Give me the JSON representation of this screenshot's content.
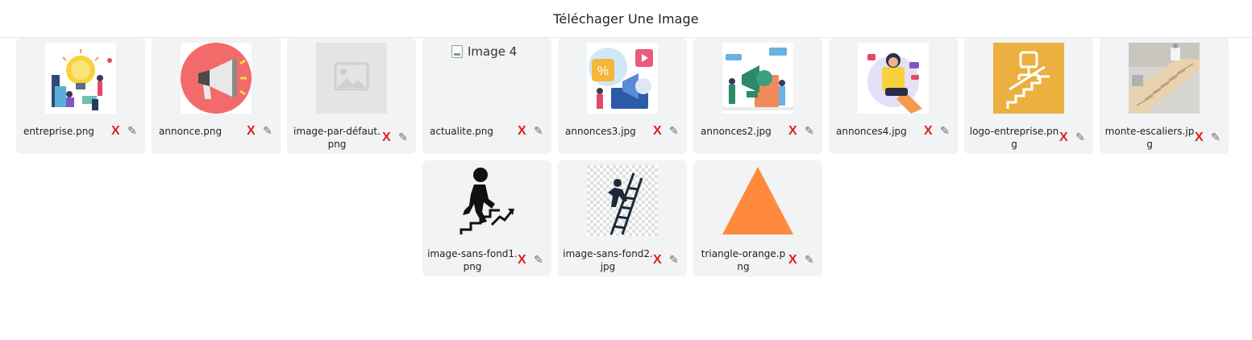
{
  "header": {
    "title": "Téléchager Une Image"
  },
  "images": [
    {
      "filename": "entreprise.png",
      "thumb_icon": "lightbulb-illustration",
      "delete_label": "X",
      "edit_icon": "pencil-icon"
    },
    {
      "filename": "annonce.png",
      "thumb_icon": "megaphone-illustration",
      "delete_label": "X",
      "edit_icon": "pencil-icon"
    },
    {
      "filename": "image-par-défaut.png",
      "thumb_icon": "placeholder-image",
      "delete_label": "X",
      "edit_icon": "pencil-icon"
    },
    {
      "filename": "actualite.png",
      "thumb_alt": "Image 4",
      "thumb_icon": "broken-image-icon",
      "delete_label": "X",
      "edit_icon": "pencil-icon"
    },
    {
      "filename": "annonces3.jpg",
      "thumb_icon": "marketing-illustration",
      "delete_label": "X",
      "edit_icon": "pencil-icon"
    },
    {
      "filename": "annonces2.jpg",
      "thumb_icon": "megaphone-crowd-illustration",
      "delete_label": "X",
      "edit_icon": "pencil-icon"
    },
    {
      "filename": "annonces4.jpg",
      "thumb_icon": "woman-phone-illustration",
      "delete_label": "X",
      "edit_icon": "pencil-icon"
    },
    {
      "filename": "logo-entreprise.png",
      "thumb_icon": "stairlift-logo",
      "delete_label": "X",
      "edit_icon": "pencil-icon"
    },
    {
      "filename": "monte-escaliers.jpg",
      "thumb_icon": "stairlift-photo",
      "delete_label": "X",
      "edit_icon": "pencil-icon"
    },
    {
      "filename": "image-sans-fond1.png",
      "thumb_icon": "man-climbing-stairs-icon",
      "delete_label": "X",
      "edit_icon": "pencil-icon"
    },
    {
      "filename": "image-sans-fond2.jpg",
      "thumb_icon": "man-climbing-ladder-icon",
      "delete_label": "X",
      "edit_icon": "pencil-icon"
    },
    {
      "filename": "triangle-orange.png",
      "thumb_icon": "orange-triangle",
      "delete_label": "X",
      "edit_icon": "pencil-icon"
    }
  ],
  "colors": {
    "card_bg": "#f2f3f5",
    "delete": "#e02020",
    "edit": "#6b6b6b",
    "triangle": "#ff8a3d",
    "logo_bg": "#ebb03f",
    "megaphone_bg": "#f26a6a"
  }
}
